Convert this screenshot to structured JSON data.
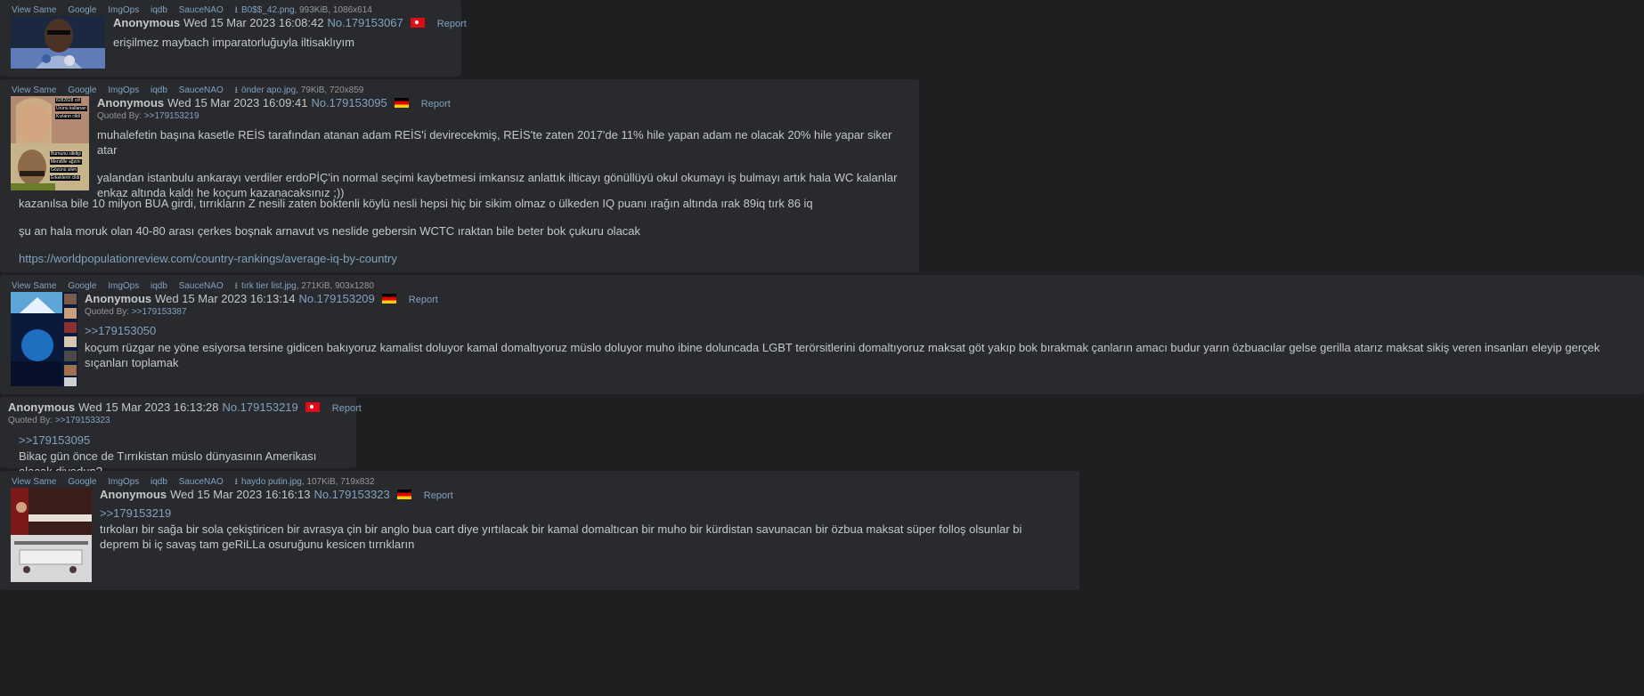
{
  "imglinks": {
    "view_same": "View Same",
    "google": "Google",
    "imgops": "ImgOps",
    "iqdb": "iqdb",
    "saucenao": "SauceNAO"
  },
  "posts": [
    {
      "file": {
        "name": "B0$$_42.png",
        "meta": ", 993KiB, 1086x614"
      },
      "name": "Anonymous",
      "date": "Wed 15 Mar 2023 16:08:42",
      "no": "No.179153067",
      "flag": "tr",
      "report": "Report",
      "quoted_by": "",
      "lines": [
        "erişilmez maybach imparatorluğuyla iltisaklıyım"
      ]
    },
    {
      "file": {
        "name": "önder apo.jpg",
        "meta": ", 79KiB, 720x859"
      },
      "name": "Anonymous",
      "date": "Wed 15 Mar 2023 16:09:41",
      "no": "No.179153095",
      "flag": "de",
      "report": "Report",
      "quoted_by_label": "Quoted By:",
      "quoted_by": ">>179153219",
      "lines": [
        "muhalefetin başına kasetle REİS tarafından atanan adam REİS'i devirecekmiş, REİS'te zaten 2017'de 11% hile yapan adam ne olacak 20% hile yapar siker atar",
        "yalandan istanbulu ankarayı verdiler erdoPİÇ'in normal seçimi kaybetmesi imkansız anlattık iltica­yı gönüllüyü okul okumayı iş bulmayı artık hala WC kalanlar enkaz altında kaldı he koçum kazanacaksınız ;))",
        "kazanılsa bile 10 milyon BUA girdi, tırrıkların Z nesili zaten boktenli köylü nesli hepsi hiç bir sikim olmaz o ülkeden IQ puanı ırağın altında ırak 89iq tırk 86 iq",
        "şu an hala moruk olan 40-80 arası çerkes boşnak arnavut vs neslide gebersin WCTC ıraktan bile beter bok çukuru olacak",
        "https://worldpopulationreview.com/country-rankings/average-iq-by-country"
      ],
      "thumb_text": [
        "8282828 cilt",
        "Ürünü kullanan",
        "Kızların cildi",
        "Burnunu silidigi",
        "Mendille ağzını",
        "Gözünü silen",
        "Erkeklerin cildi"
      ]
    },
    {
      "file": {
        "name": "tırk tier list.jpg",
        "meta": ", 271KiB, 903x1280"
      },
      "name": "Anonymous",
      "date": "Wed 15 Mar 2023 16:13:14",
      "no": "No.179153209",
      "flag": "de",
      "report": "Report",
      "quoted_by_label": "Quoted By:",
      "quoted_by": ">>179153387",
      "quote_link": ">>179153050",
      "lines": [
        "koçum rüzgar ne yöne esiyorsa tersine gidicen bakıyoruz kamalist doluyor kamal domaltıyoruz müslo doluyor muho ibine doluncada LGBT terörsitlerini domaltıyoruz maksat göt yakıp bok bırakmak çanların amacı budur yarın özbuacılar gelse gerilla atarız maksat sikiş veren insanları eleyip gerçek sıçanları toplamak"
      ]
    },
    {
      "name": "Anonymous",
      "date": "Wed 15 Mar 2023 16:13:28",
      "no": "No.179153219",
      "flag": "tr",
      "report": "Report",
      "quoted_by_label": "Quoted By:",
      "quoted_by": ">>179153323",
      "quote_link": ">>179153095",
      "lines": [
        "Bikaç gün önce de Tırrıkistan müslo dünyasının Amerikası olacak diyodun?"
      ]
    },
    {
      "file": {
        "name": "haydo putin.jpg",
        "meta": ", 107KiB, 719x832"
      },
      "name": "Anonymous",
      "date": "Wed 15 Mar 2023 16:16:13",
      "no": "No.179153323",
      "flag": "de",
      "report": "Report",
      "quoted_by": "",
      "quote_link": ">>179153219",
      "lines": [
        "tırkoları bir sağa bir sola çekiştiricen bir avrasya çin bir anglo bua cart diye yırtılacak bir kamal domaltıcan bir muho bir kürdistan savunacan bir özbua maksat süper folloş olsunlar bi deprem bi iç savaş tam geRiLLa osuruğunu kesicen tırrıkların"
      ]
    }
  ],
  "colors": {
    "bg": "#1d1f21",
    "post_bg": "#282a2e",
    "text": "#c5c8c6",
    "link": "#81a2be",
    "muted": "#969896",
    "flag_tr": "#e30a17"
  },
  "icons": [
    "download-icon",
    "flag-tr-icon",
    "flag-de-icon"
  ]
}
